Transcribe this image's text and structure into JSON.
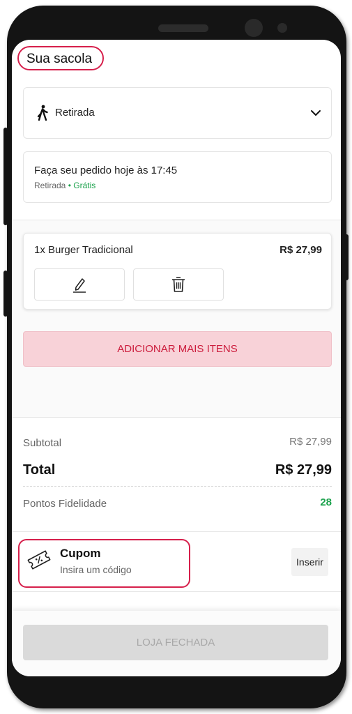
{
  "header": {
    "title": "Sua sacola"
  },
  "delivery_mode": {
    "label": "Retirada",
    "icon": "walking-person-icon",
    "dropdown_icon": "chevron-down-icon"
  },
  "order_info": {
    "time_text": "Faça seu pedido hoje às 17:45",
    "mode_text": "Retirada",
    "separator": " • ",
    "price_text": "Grátis"
  },
  "cart": {
    "items": [
      {
        "name": "1x Burger Tradicional",
        "price": "R$ 27,99",
        "edit_icon": "pencil-icon",
        "delete_icon": "trash-icon"
      }
    ],
    "add_more_label": "ADICIONAR MAIS ITENS"
  },
  "summary": {
    "subtotal_label": "Subtotal",
    "subtotal_value": "R$ 27,99",
    "total_label": "Total",
    "total_value": "R$ 27,99",
    "points_label": "Pontos Fidelidade",
    "points_value": "28"
  },
  "coupon": {
    "title": "Cupom",
    "subtitle": "Insira um código",
    "button_label": "Inserir",
    "icon": "coupon-ticket-icon"
  },
  "footer": {
    "button_label": "LOJA FECHADA"
  },
  "colors": {
    "accent": "#d61f4b",
    "add_button_bg": "#f8d2d8",
    "add_button_text": "#cc1c3c",
    "green": "#1aa14b",
    "disabled_bg": "#dadada"
  }
}
